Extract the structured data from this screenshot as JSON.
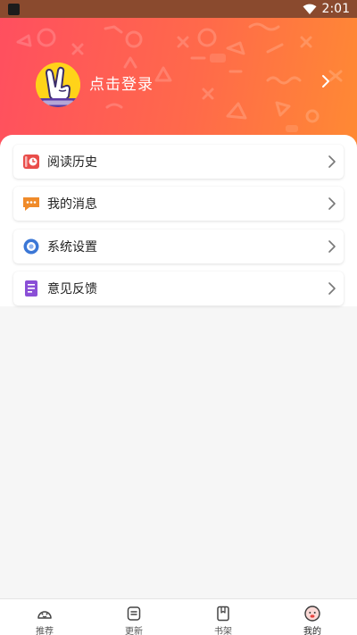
{
  "status_bar": {
    "time": "2:01",
    "left_icon": "app-notification-icon",
    "right_icons": [
      "wifi-icon",
      "battery-icon"
    ]
  },
  "header": {
    "avatar_icon": "victory-hand-avatar",
    "login_label": "点击登录",
    "chevron_icon": "chevron-right-icon"
  },
  "menu": {
    "items": [
      {
        "label": "阅读历史",
        "icon": "history-clock-icon",
        "color": "#e94d4a"
      },
      {
        "label": "我的消息",
        "icon": "message-bubble-icon",
        "color": "#f08b2a"
      },
      {
        "label": "系统设置",
        "icon": "settings-dial-icon",
        "color": "#3b77d6"
      },
      {
        "label": "意见反馈",
        "icon": "feedback-document-icon",
        "color": "#8a4fd6"
      }
    ]
  },
  "bottom_nav": {
    "items": [
      {
        "label": "推荐",
        "icon": "recommend-face-icon",
        "active": false
      },
      {
        "label": "更新",
        "icon": "update-list-icon",
        "active": false
      },
      {
        "label": "书架",
        "icon": "bookshelf-icon",
        "active": false
      },
      {
        "label": "我的",
        "icon": "profile-face-icon",
        "active": true
      }
    ]
  },
  "colors": {
    "header_gradient_start": "#ff4f5f",
    "header_gradient_end": "#ff8a33",
    "status_bar": "#8a4a2e",
    "active_accent": "#e9433f"
  }
}
